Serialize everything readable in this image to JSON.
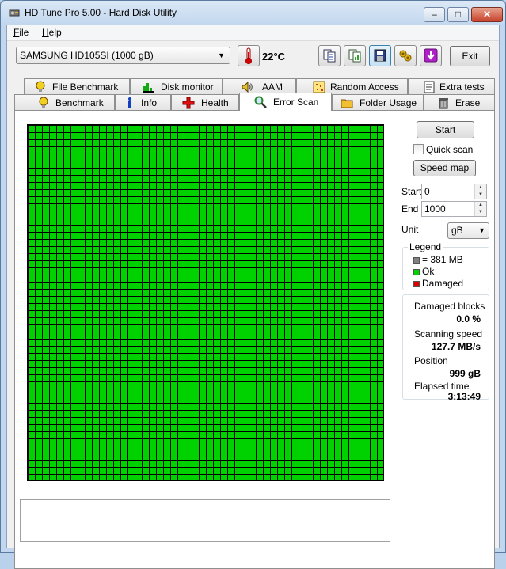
{
  "window": {
    "title": "HD Tune Pro 5.00 - Hard Disk Utility",
    "minimize_glyph": "–",
    "maximize_glyph": "□",
    "close_glyph": "✕"
  },
  "menu": {
    "file_u": "F",
    "file_rest": "ile",
    "help_u": "H",
    "help_rest": "elp"
  },
  "toolbar": {
    "drive": "SAMSUNG HD105SI (1000 gB)",
    "temperature": "22°C",
    "exit_label": "Exit",
    "icons": [
      "thermometer-icon",
      "copy-info-icon",
      "copy-screen-icon",
      "save-icon",
      "options-icon",
      "download-icon"
    ]
  },
  "tabs": {
    "row1": [
      {
        "label": "File Benchmark",
        "icon": "file-benchmark-icon"
      },
      {
        "label": "Disk monitor",
        "icon": "disk-monitor-icon"
      },
      {
        "label": "AAM",
        "icon": "speaker-icon"
      },
      {
        "label": "Random Access",
        "icon": "random-access-icon"
      },
      {
        "label": "Extra tests",
        "icon": "extra-tests-icon"
      }
    ],
    "row2": [
      {
        "label": "Benchmark",
        "icon": "benchmark-icon"
      },
      {
        "label": "Info",
        "icon": "info-icon"
      },
      {
        "label": "Health",
        "icon": "health-icon"
      },
      {
        "label": "Error Scan",
        "icon": "magnifier-icon",
        "active": true
      },
      {
        "label": "Folder Usage",
        "icon": "folder-icon"
      },
      {
        "label": "Erase",
        "icon": "trash-icon"
      }
    ]
  },
  "scan": {
    "start_label": "Start",
    "quick_scan_label": "Quick scan",
    "quick_scan_checked": false,
    "speed_map_label": "Speed map",
    "start_field_label": "Start",
    "start_value": "0",
    "end_field_label": "End",
    "end_value": "1000",
    "unit_label": "Unit",
    "unit_value": "gB"
  },
  "legend": {
    "title": "Legend",
    "block_size": "= 381 MB",
    "ok": "Ok",
    "damaged": "Damaged",
    "colors": {
      "block": "#808080",
      "ok": "#00d200",
      "damaged": "#e00000"
    }
  },
  "stats": {
    "damaged_blocks_label": "Damaged blocks",
    "damaged_blocks_value": "0.0 %",
    "scanning_speed_label": "Scanning speed",
    "scanning_speed_value": "127.7 MB/s",
    "position_label": "Position",
    "position_value": "999 gB",
    "elapsed_label": "Elapsed time",
    "elapsed_value": "3:13:49"
  }
}
